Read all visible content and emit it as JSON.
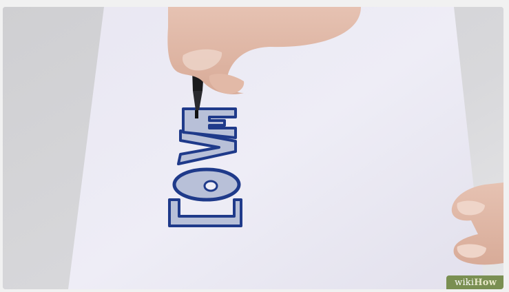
{
  "photo": {
    "drawn_word": "LOVE",
    "ink_color": "#1f3a8a",
    "fill_color": "#b8c0d8"
  },
  "watermark": {
    "part1": "wiki",
    "part2": "How",
    "bg_color": "#7a8f52"
  }
}
